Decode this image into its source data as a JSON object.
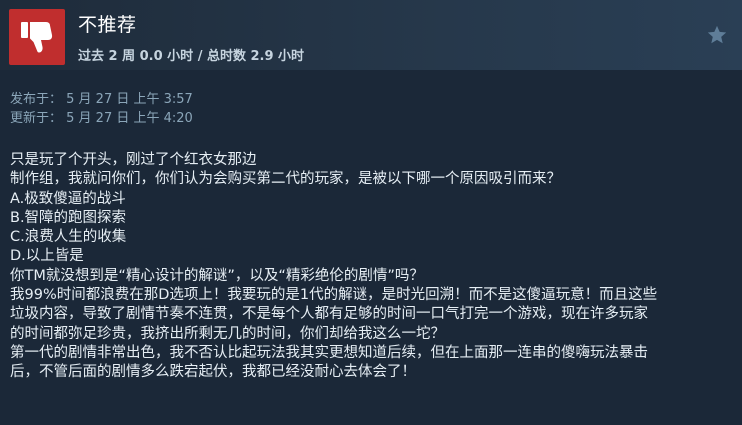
{
  "review": {
    "verdict": "不推荐",
    "playtime": "过去 2 周 0.0 小时 / 总时数 2.9 小时",
    "posted": "发布于： 5 月 27 日 上午 3:57",
    "updated": "更新于： 5 月 27 日 上午 4:20",
    "thumb_icon": "thumbs-down-icon",
    "star_icon": "star-icon",
    "colors": {
      "thumb_bg": "#c02e2e",
      "star": "#5f7d98"
    },
    "body_lines": [
      "只是玩了个开头，刚过了个红衣女那边",
      "制作组，我就问你们，你们认为会购买第二代的玩家，是被以下哪一个原因吸引而来？",
      "A.极致傻逼的战斗",
      "B.智障的跑图探索",
      "C.浪费人生的收集",
      "D.以上皆是",
      "你TM就没想到是“精心设计的解谜”，以及“精彩绝伦的剧情”吗？",
      "我99%时间都浪费在那D选项上！我要玩的是1代的解谜，是时光回溯！而不是这傻逼玩意！而且这些",
      "垃圾内容，导致了剧情节奏不连贯，不是每个人都有足够的时间一口气打完一个游戏，现在许多玩家",
      "的时间都弥足珍贵，我挤出所剩无几的时间，你们却给我这么一坨？",
      "第一代的剧情非常出色，我不否认比起玩法我其实更想知道后续，但在上面那一连串的傻嗨玩法暴击",
      "后，不管后面的剧情多么跌宕起伏，我都已经没耐心去体会了！"
    ]
  }
}
